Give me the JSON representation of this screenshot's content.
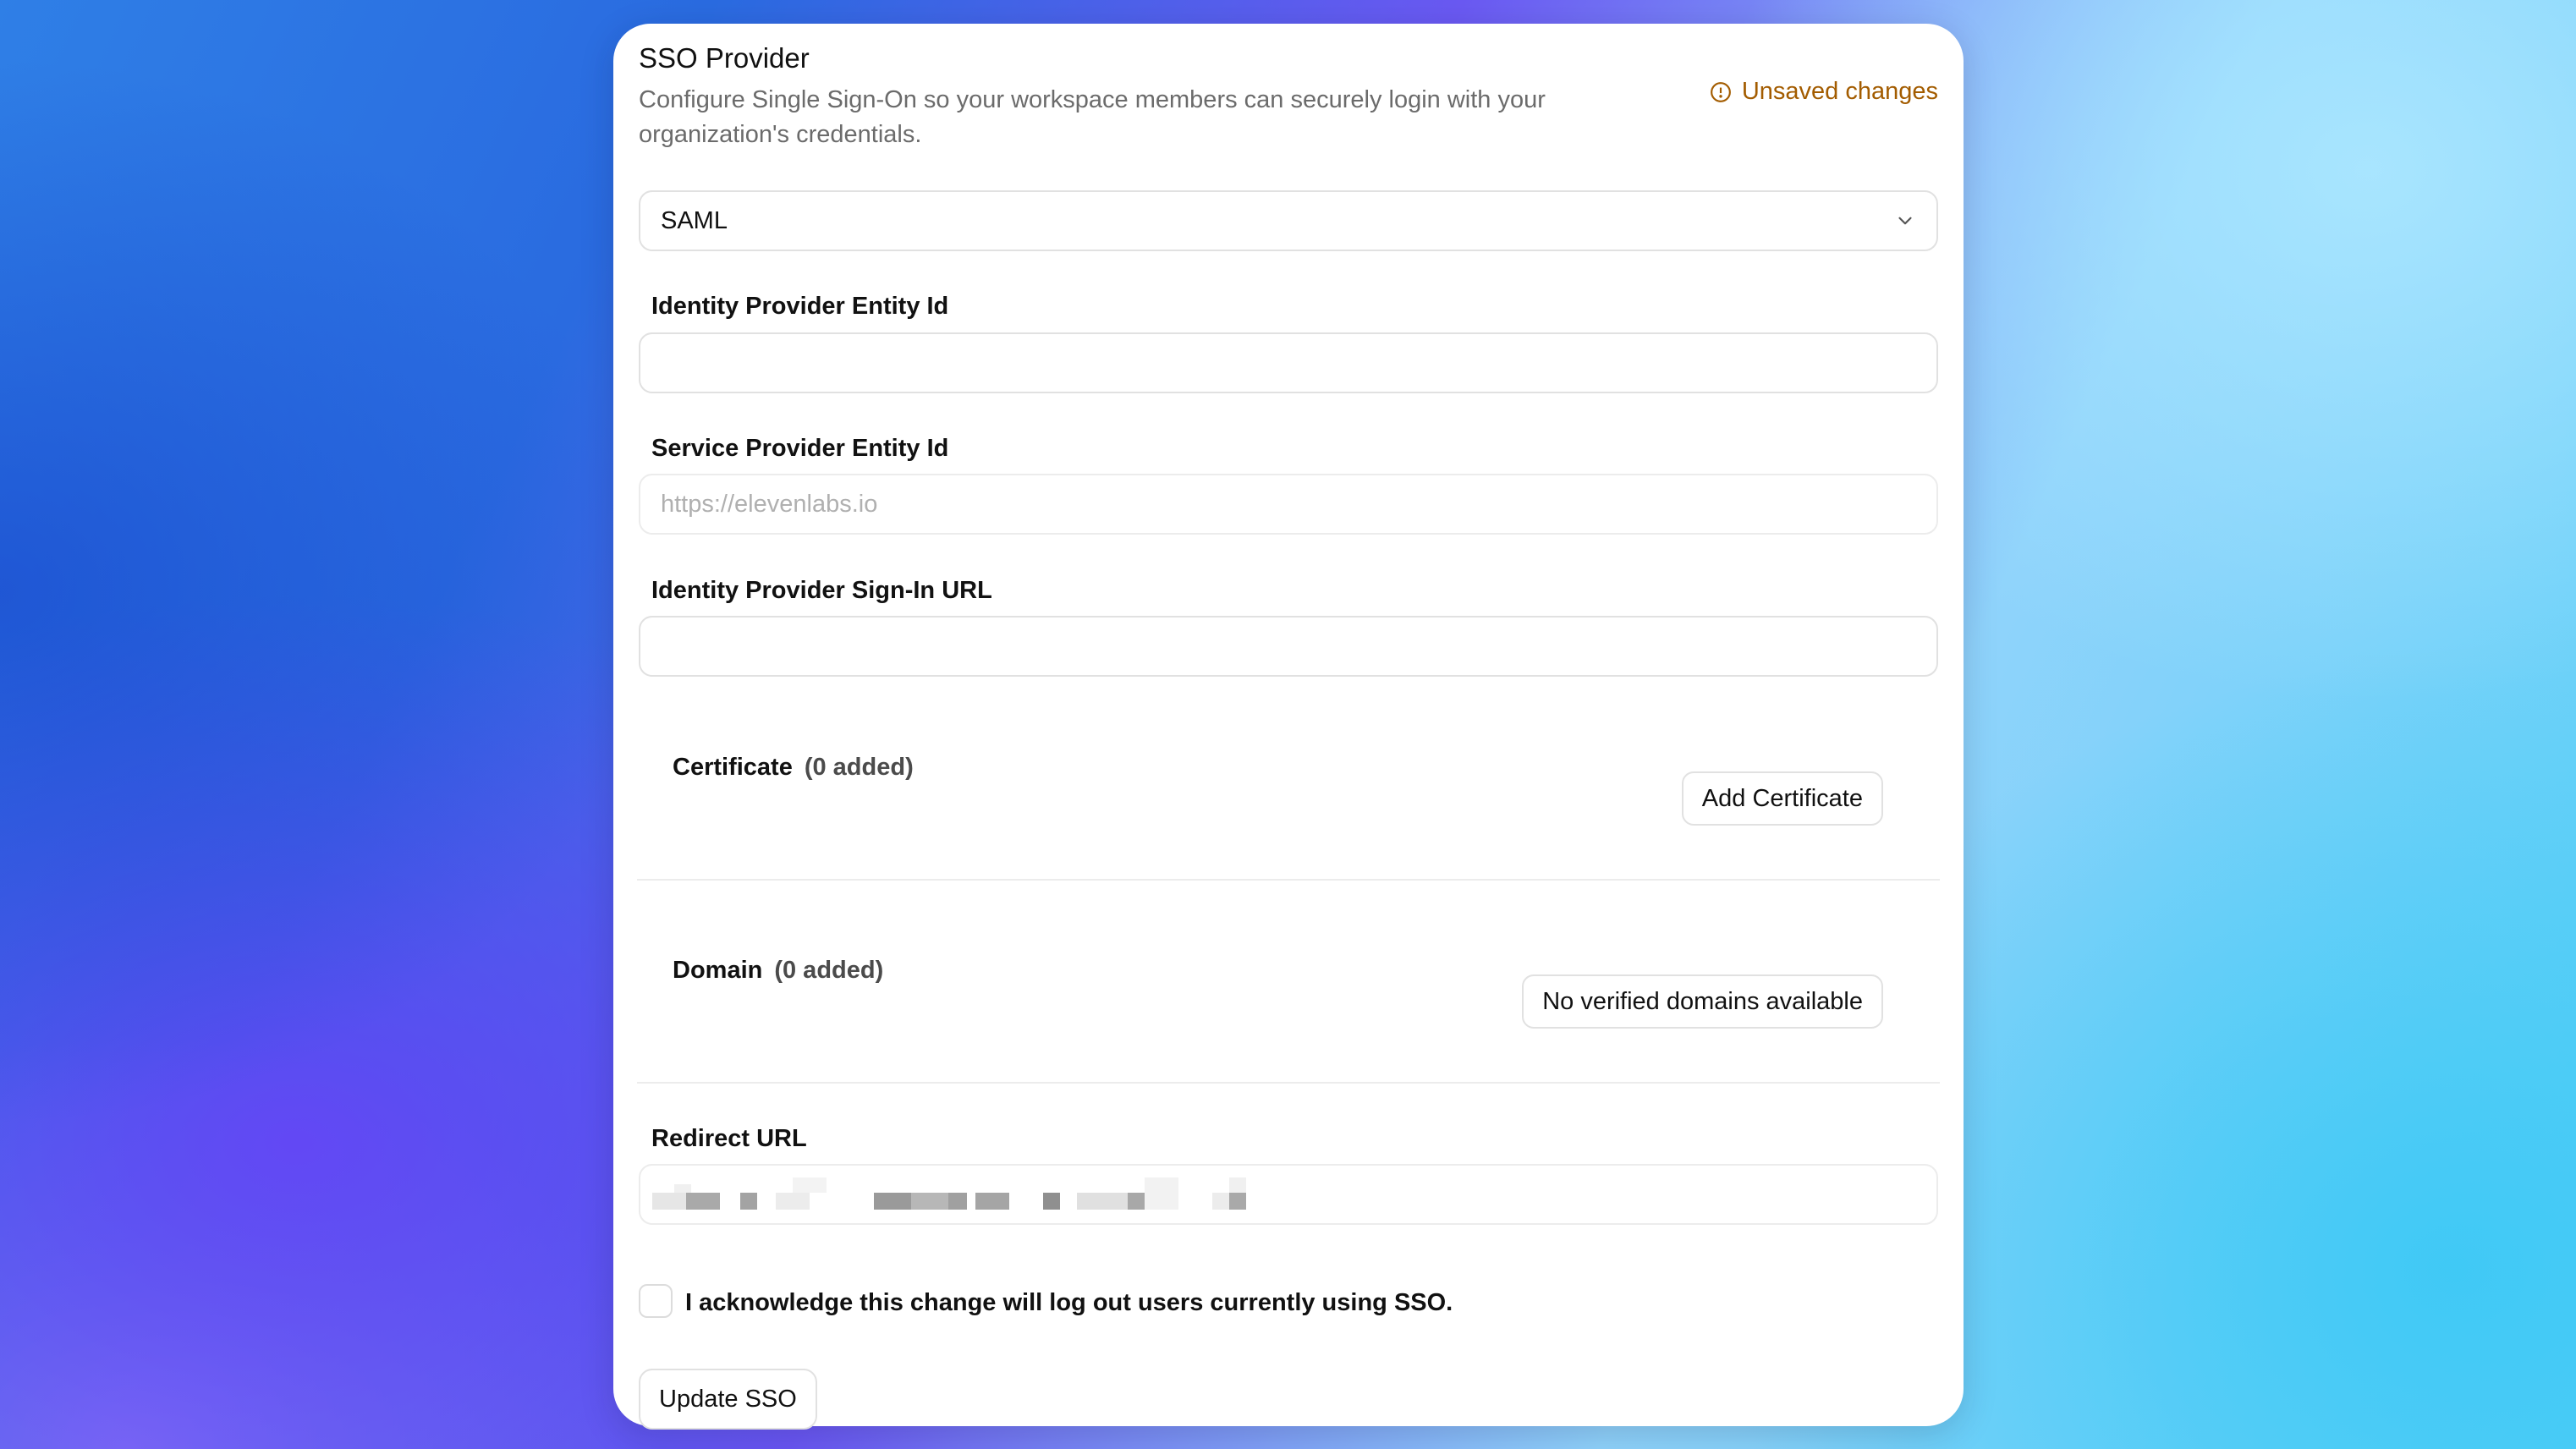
{
  "header": {
    "title": "SSO Provider",
    "description": "Configure Single Sign-On so your workspace members can securely login with your organization's credentials.",
    "status": "Unsaved changes",
    "status_icon": "info-circle-icon",
    "status_color": "#a35c00"
  },
  "protocol_select": {
    "value": "SAML",
    "icon": "chevron-down-icon"
  },
  "fields": {
    "idp_entity_id": {
      "label": "Identity Provider Entity Id",
      "value": "",
      "placeholder": ""
    },
    "sp_entity_id": {
      "label": "Service Provider Entity Id",
      "value": "",
      "placeholder": "https://elevenlabs.io"
    },
    "idp_signin_url": {
      "label": "Identity Provider Sign-In URL",
      "value": "",
      "placeholder": ""
    }
  },
  "certificate": {
    "label": "Certificate",
    "count": "(0 added)",
    "button": "Add Certificate"
  },
  "domain": {
    "label": "Domain",
    "count": "(0 added)",
    "button": "No verified domains available"
  },
  "redirect": {
    "label": "Redirect URL"
  },
  "acknowledge": {
    "label": "I acknowledge this change will log out users currently using SSO.",
    "checked": false
  },
  "submit": {
    "label": "Update SSO"
  }
}
